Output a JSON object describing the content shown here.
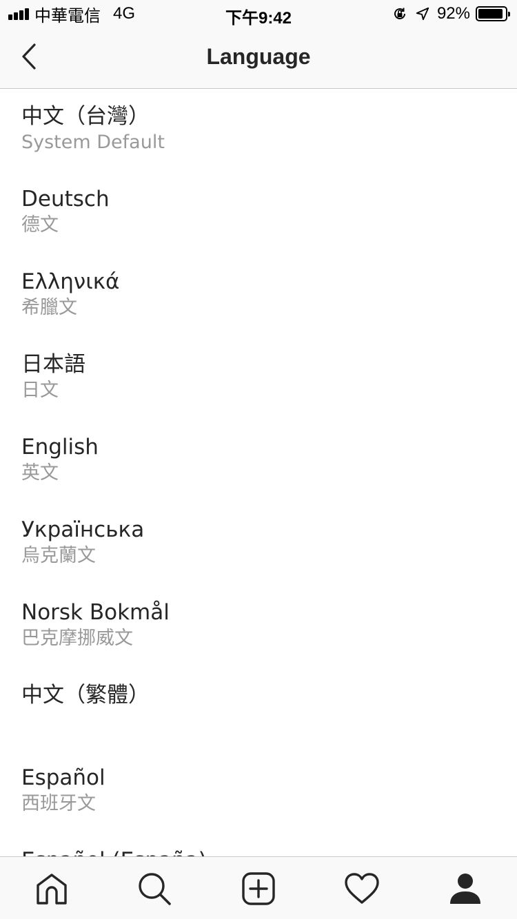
{
  "status_bar": {
    "carrier": "中華電信",
    "network": "4G",
    "time": "下午9:42",
    "battery_percent": "92%",
    "battery_level": 0.92,
    "icons": [
      "signal-bars-icon",
      "orientation-lock-icon",
      "location-arrow-icon",
      "battery-icon"
    ]
  },
  "nav": {
    "title": "Language",
    "back_icon": "chevron-left-icon"
  },
  "languages": [
    {
      "name": "中文（台灣）",
      "sub": "System Default"
    },
    {
      "name": "Deutsch",
      "sub": "德文"
    },
    {
      "name": "Ελληνικά",
      "sub": "希臘文"
    },
    {
      "name": "日本語",
      "sub": "日文"
    },
    {
      "name": "English",
      "sub": "英文"
    },
    {
      "name": "Українська",
      "sub": "烏克蘭文"
    },
    {
      "name": "Norsk Bokmål",
      "sub": "巴克摩挪威文"
    },
    {
      "name": "中文（繁體）",
      "sub": ""
    },
    {
      "name": "Español",
      "sub": "西班牙文"
    },
    {
      "name": "Español (España)",
      "sub": ""
    }
  ],
  "tab_bar": {
    "icons": [
      "home-icon",
      "search-icon",
      "add-post-icon",
      "heart-icon",
      "profile-icon"
    ],
    "active": "profile-icon"
  }
}
